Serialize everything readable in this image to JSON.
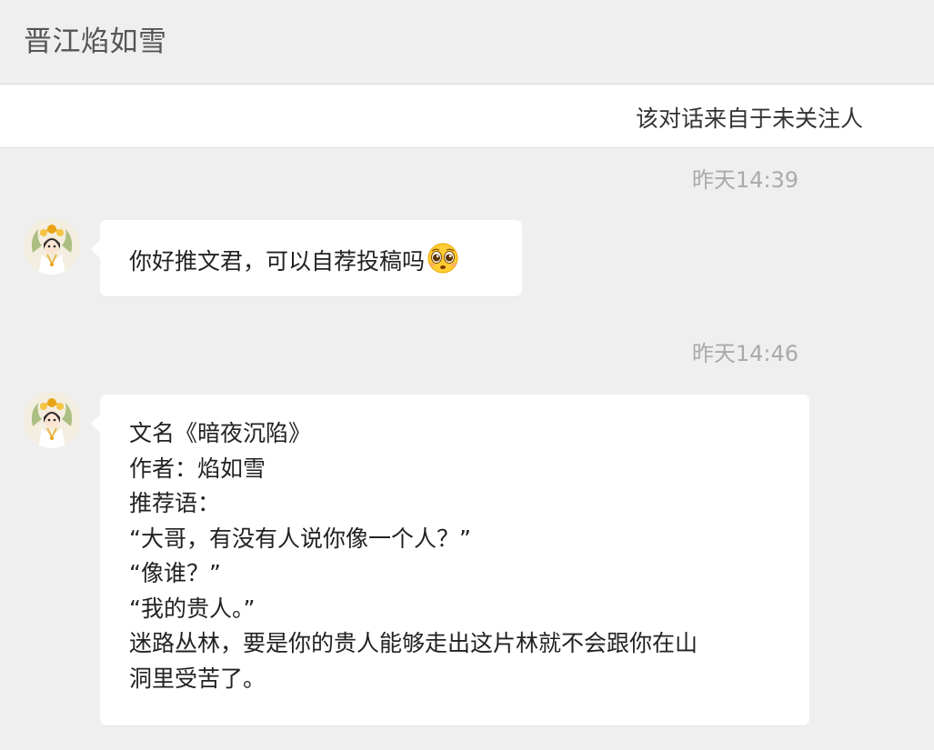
{
  "header": {
    "title": "晋江焰如雪"
  },
  "notice": {
    "text": "该对话来自于未关注人"
  },
  "messages": [
    {
      "timestamp": "昨天14:39",
      "text": "你好推文君，可以自荐投稿吗",
      "emoji": "pleading-face-emoji"
    },
    {
      "timestamp": "昨天14:46",
      "lines": [
        "文名《暗夜沉陷》",
        "作者：焰如雪",
        "推荐语：",
        "“大哥，有没有人说你像一个人？”",
        "“像谁？”",
        "“我的贵人。”",
        "迷路丛林，要是你的贵人能够走出这片林就不会跟你在山",
        "洞里受苦了。"
      ]
    }
  ],
  "colors": {
    "background": "#efefef",
    "bubble": "#ffffff",
    "timestamp": "#aaaaaa",
    "header_text": "#555555"
  }
}
